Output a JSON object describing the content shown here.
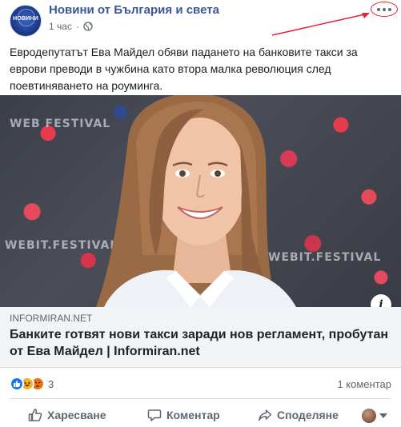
{
  "page": {
    "name": "Новини от България и света",
    "avatar_text": "НОВИНИ",
    "time": "1 час",
    "time_separator": "·",
    "privacy_icon": "globe-icon"
  },
  "post": {
    "text": "Евродепутатът Ева Майдел обяви падането на банковите такси за еврови преводи в чужбина като втора малка революция след поевтиняването на роуминга."
  },
  "image": {
    "backdrop_text_1": "WEB FESTIVAL",
    "backdrop_text_2": "WEBIT.FESTIVAL"
  },
  "link": {
    "domain": "INFORMIRAN.NET",
    "title": "Банките готвят нови такси заради нов регламент, пробутан от Ева Майдел | Informiran.net",
    "info_label": "i"
  },
  "stats": {
    "reaction_count": "3",
    "reactions": [
      "like-icon",
      "haha-icon",
      "angry-icon"
    ],
    "comment_count": "1 коментар"
  },
  "actions": {
    "like": "Харесване",
    "comment": "Коментар",
    "share": "Споделяне"
  },
  "colors": {
    "page_name": "#385898",
    "annotation": "#e0243a",
    "like_blue": "#1877f2"
  }
}
